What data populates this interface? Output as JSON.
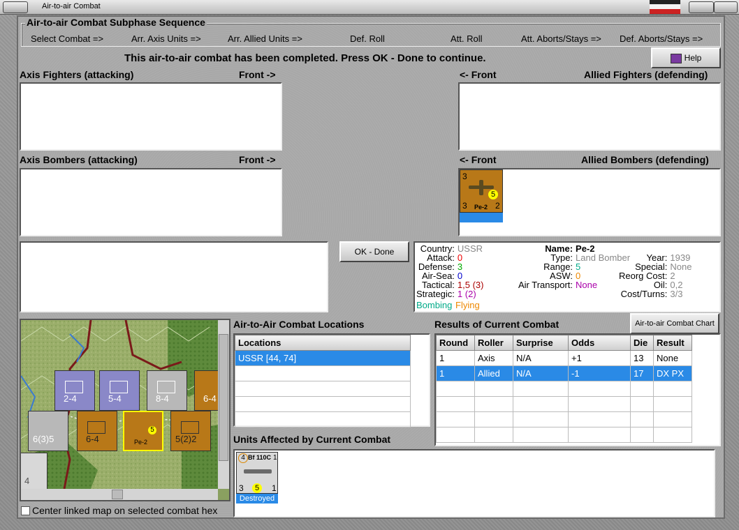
{
  "window": {
    "title": "Air-to-air Combat"
  },
  "sequence": {
    "title": "Air-to-air Combat Subphase Sequence",
    "steps": [
      "Select Combat =>",
      "Arr. Axis Units =>",
      "Arr. Allied Units =>",
      "Def. Roll",
      "Att. Roll",
      "Att. Aborts/Stays =>",
      "Def. Aborts/Stays =>"
    ]
  },
  "status_message": "This air-to-air combat has been completed.  Press OK - Done to continue.",
  "help_label": "Help",
  "panels": {
    "axis_fighters": "Axis Fighters (attacking)",
    "axis_bombers": "Axis Bombers (attacking)",
    "allied_fighters": "Allied Fighters (defending)",
    "allied_bombers": "Allied Bombers (defending)",
    "front_right": "Front ->",
    "front_left": "<- Front"
  },
  "bomber_unit": {
    "name": "Pe-2",
    "left": "3",
    "right": "2",
    "top": "3",
    "badge": "5"
  },
  "ok_label": "OK - Done",
  "unit_info": {
    "country_label": "Country:",
    "country": "USSR",
    "attack_label": "Attack:",
    "attack": "0",
    "defense_label": "Defense:",
    "defense": "3",
    "airsea_label": "Air-Sea:",
    "airsea": "0",
    "tactical_label": "Tactical:",
    "tactical": "1,5 (3)",
    "strategic_label": "Strategic:",
    "strategic": "1 (2)",
    "bombing": "Bombing",
    "flying": "Flying",
    "name_label": "Name:",
    "name": "Pe-2",
    "type_label": "Type:",
    "type": "Land Bomber",
    "year_label": "Year:",
    "year": "1939",
    "range_label": "Range:",
    "range": "5",
    "special_label": "Special:",
    "special": "None",
    "asw_label": "ASW:",
    "asw": "0",
    "reorg_label": "Reorg Cost:",
    "reorg": "2",
    "transport_label": "Air Transport:",
    "transport": "None",
    "oil_label": "Oil:",
    "oil": "0,2",
    "cost_label": "Cost/Turns:",
    "cost": "3/3"
  },
  "locations": {
    "title": "Air-to-Air Combat Locations",
    "header": "Locations",
    "rows": [
      "USSR [44, 74]"
    ]
  },
  "results": {
    "title": "Results of Current Combat",
    "chart_button": "Air-to-air Combat Chart",
    "headers": [
      "Round",
      "Roller",
      "Surprise",
      "Odds",
      "Die",
      "Result"
    ],
    "rows": [
      [
        "1",
        "Axis",
        "N/A",
        "+1",
        "13",
        "None"
      ],
      [
        "1",
        "Allied",
        "N/A",
        "-1",
        "17",
        "DX PX"
      ]
    ]
  },
  "affected": {
    "title": "Units Affected by Current Combat",
    "unit_name": "Bf 110C",
    "unit_top_left": "4",
    "unit_top_right": "1",
    "unit_left": "3",
    "unit_badge": "5",
    "unit_right": "1",
    "status": "Destroyed"
  },
  "map": {
    "center_checkbox": "Center linked map on selected combat hex",
    "counters": [
      "2-4",
      "5-4",
      "8-4",
      "6-4",
      "6(3)5",
      "6-4",
      "Pe-2",
      "5(2)2",
      "4"
    ]
  }
}
